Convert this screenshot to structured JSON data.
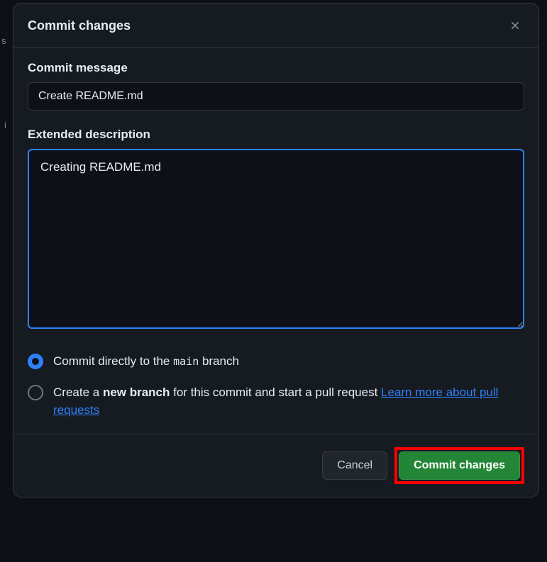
{
  "dialog": {
    "title": "Commit changes"
  },
  "fields": {
    "commit_message_label": "Commit message",
    "commit_message_value": "Create README.md",
    "extended_description_label": "Extended description",
    "extended_description_value": "Creating README.md"
  },
  "radio": {
    "direct": {
      "prefix": "Commit directly to the ",
      "branch": "main",
      "suffix": " branch"
    },
    "newbranch": {
      "prefix": "Create a ",
      "bold": "new branch",
      "suffix": " for this commit and start a pull request ",
      "link": "Learn more about pull requests"
    }
  },
  "buttons": {
    "cancel": "Cancel",
    "commit": "Commit changes"
  },
  "bg": {
    "s": "s",
    "i": "i"
  }
}
